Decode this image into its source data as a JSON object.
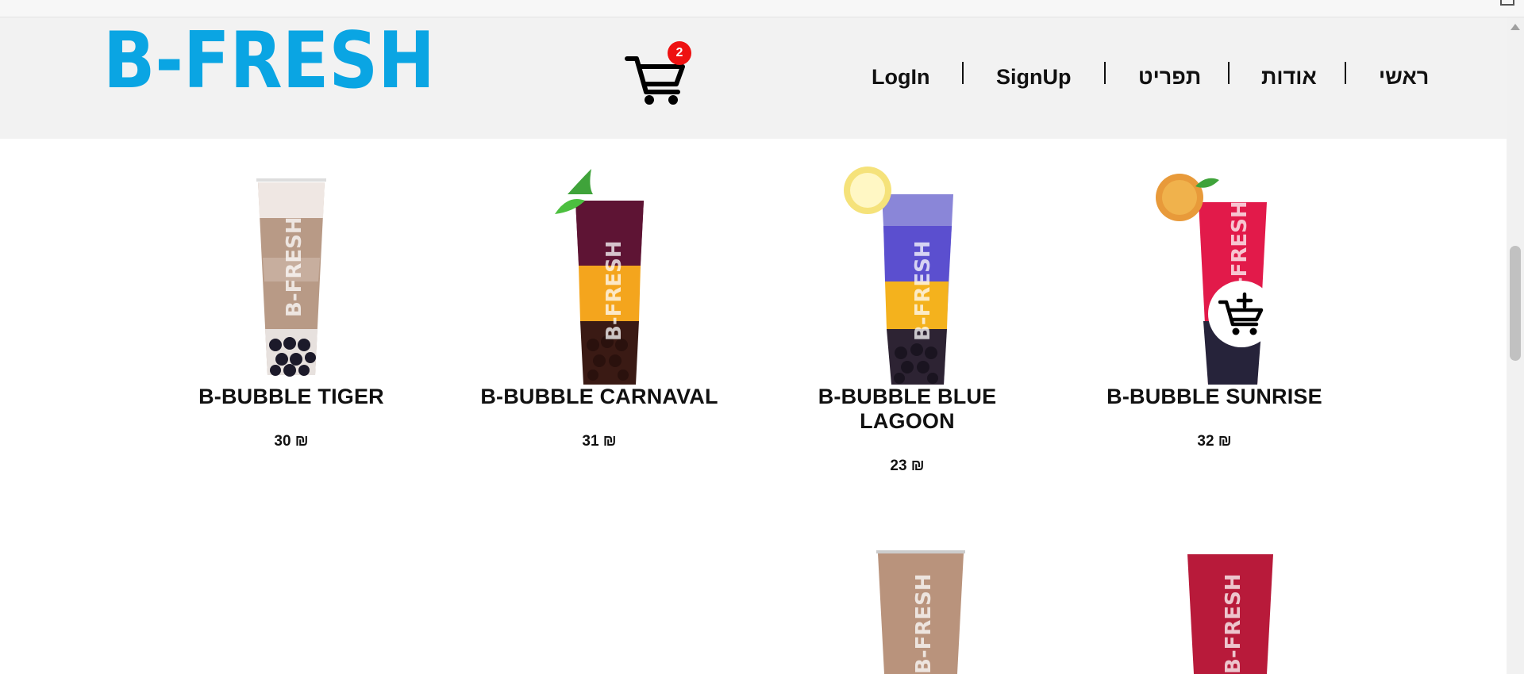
{
  "brand": {
    "logo_text": "B-FRESH",
    "logo_color": "#0aa5e3"
  },
  "cart": {
    "count": "2",
    "badge_color": "#ee1111"
  },
  "nav": {
    "home": "ראשי",
    "about": "אודות",
    "menu": "תפריט",
    "signup": "SignUp",
    "login": "LogIn"
  },
  "products": [
    {
      "name": "B-BUBBLE TIGER",
      "price": "30 ₪"
    },
    {
      "name": "B-BUBBLE CARNAVAL",
      "price": "31 ₪"
    },
    {
      "name": "B-BUBBLE BLUE LAGOON",
      "price": "23 ₪"
    },
    {
      "name": "B-BUBBLE SUNRISE",
      "price": "32 ₪"
    }
  ],
  "cup_text": "B-FRESH"
}
